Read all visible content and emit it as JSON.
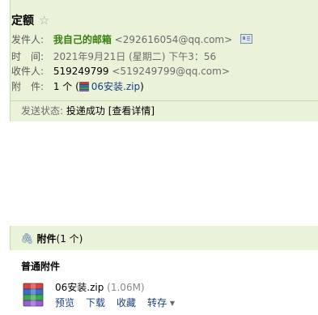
{
  "mail": {
    "subject": "定额",
    "from_label": "发件人:",
    "from_name": "我自己的邮箱",
    "from_email": "<292616054@qq.com>",
    "time_label": "时　间:",
    "time_value": "2021年9月21日 (星期二) 下午3：56",
    "to_label": "收件人:",
    "to_name": "519249799",
    "to_email": "<519249799@qq.com>",
    "attach_label": "附　件:",
    "attach_count_prefix": "1 个 (",
    "attach_filename": "06安装.zip",
    "attach_count_suffix": ")",
    "status_label": "发送状态:",
    "status_value": "投递成功",
    "status_detail": "[查看详情]"
  },
  "attachments": {
    "title": "附件",
    "count": "(1 个)",
    "section_label": "普通附件",
    "file": {
      "name": "06安装.zip",
      "size": "(1.06M)"
    },
    "actions": {
      "preview": "预览",
      "download": "下载",
      "favorite": "收藏",
      "save_to": "转存"
    }
  },
  "colors": {
    "panel_bg": "#eaf3d9",
    "sender_green": "#3a7d0f",
    "link_blue": "#1d3f7a"
  },
  "icons": [
    "star-icon",
    "vcard-icon",
    "zip-file-icon",
    "paperclip-icon",
    "caret-down-icon"
  ]
}
